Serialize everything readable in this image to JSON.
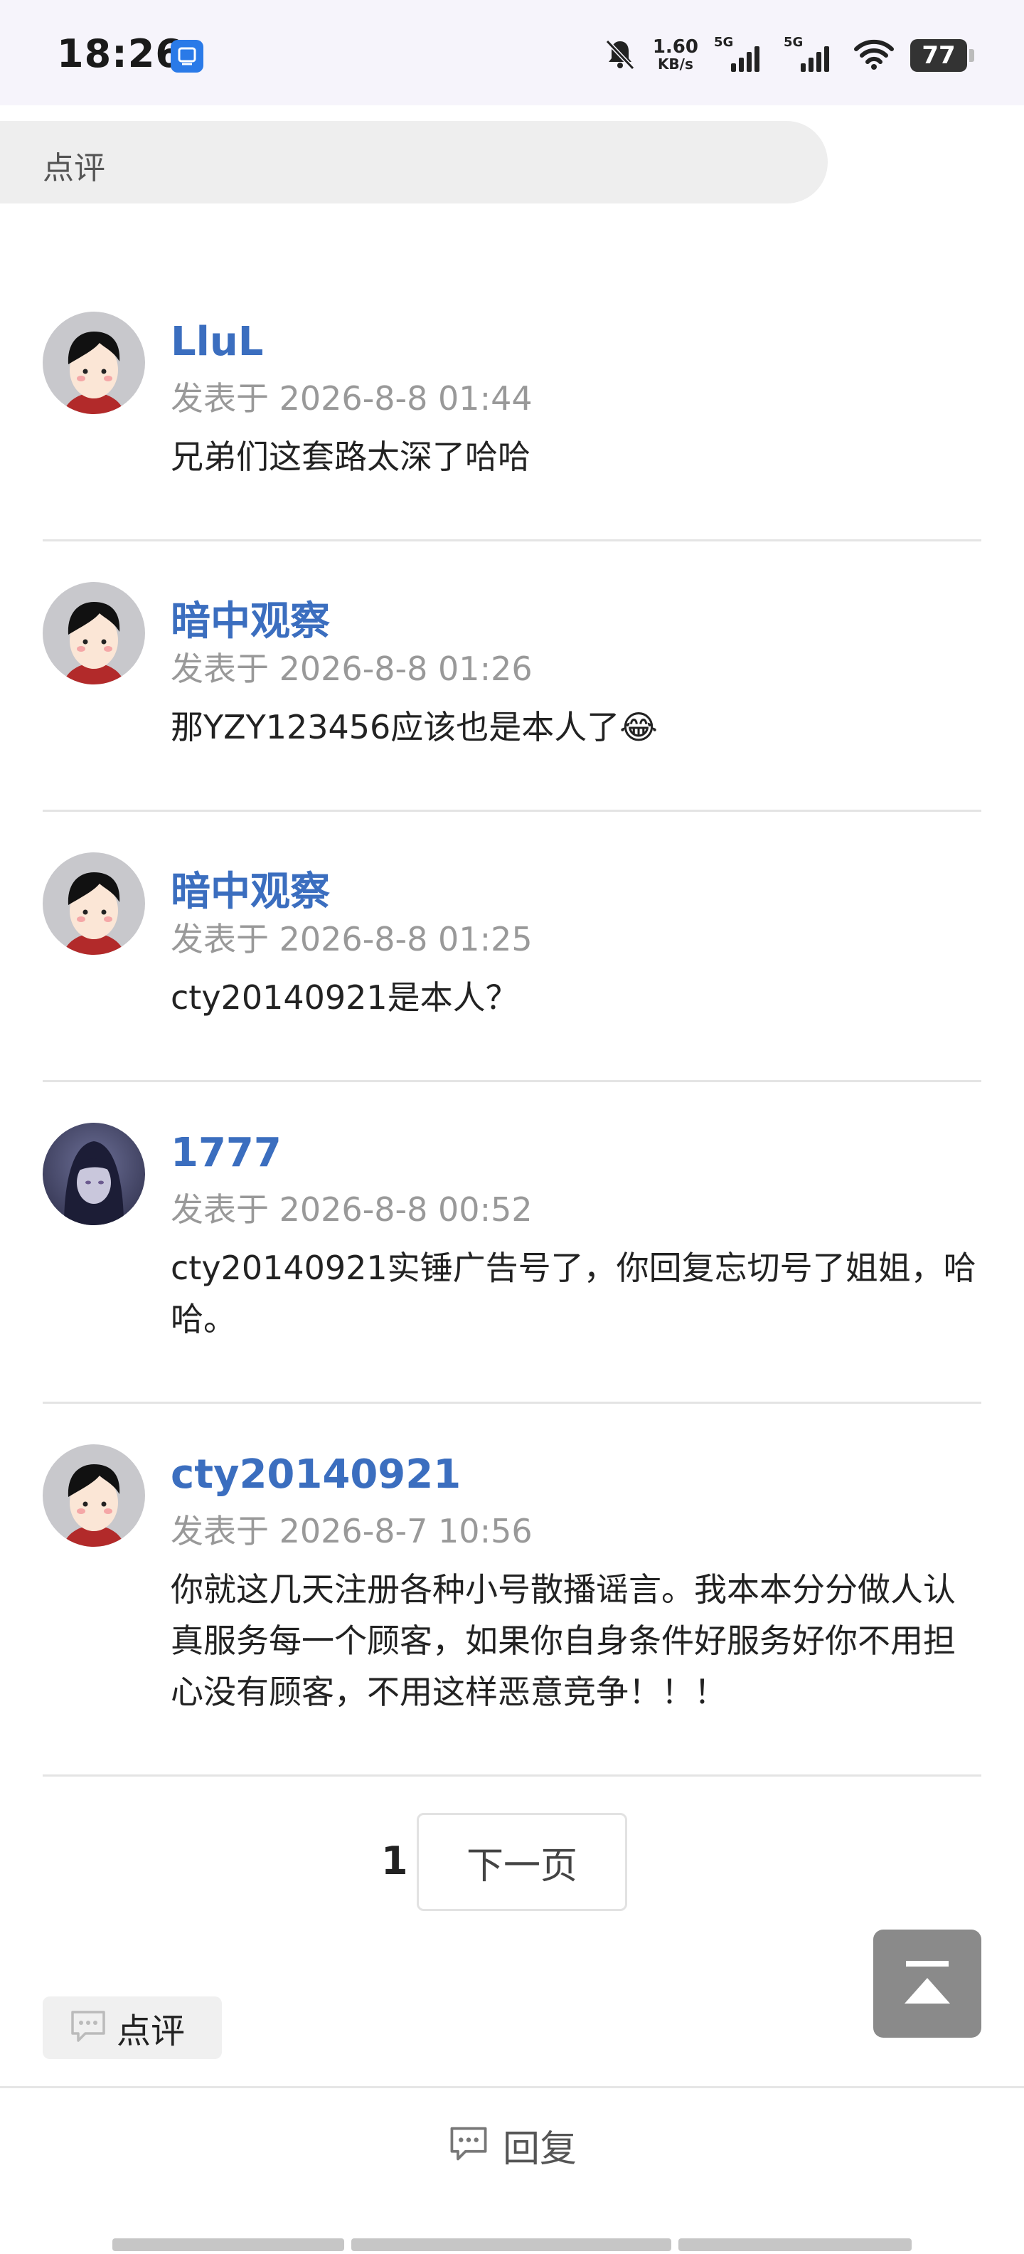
{
  "status_bar": {
    "time": "18:26",
    "speed_value": "1.60",
    "speed_unit": "KB/s",
    "sim1_label": "5G",
    "sim2_label": "5G",
    "battery": "77"
  },
  "header": {
    "tab_label": "点评"
  },
  "comments": [
    {
      "user": "LluL",
      "meta": "发表于 2026-8-8 01:44",
      "text": "兄弟们这套路太深了哈哈"
    },
    {
      "user": "暗中观察",
      "meta": "发表于 2026-8-8 01:26",
      "text": "那YZY123456应该也是本人了😂"
    },
    {
      "user": "暗中观察",
      "meta": "发表于 2026-8-8 01:25",
      "text": "cty20140921是本人？"
    },
    {
      "user": "1777",
      "meta": "发表于 2026-8-8 00:52",
      "text": "cty20140921实锤广告号了，你回复忘切号了姐姐，哈哈。"
    },
    {
      "user": "cty20140921",
      "meta": "发表于 2026-8-7 10:56",
      "text": "你就这几天注册各种小号散播谣言。我本本分分做人认真服务每一个顾客，如果你自身条件好服务好你不用担心没有顾客，不用这样恶意竞争！！！"
    }
  ],
  "pagination": {
    "current": "1",
    "next_label": "下一页"
  },
  "review_button": {
    "label": "点评"
  },
  "reply_bar": {
    "label": "回复"
  },
  "colors": {
    "username": "#3b6ebf",
    "meta": "#999999",
    "divider": "#e4e4e4"
  }
}
